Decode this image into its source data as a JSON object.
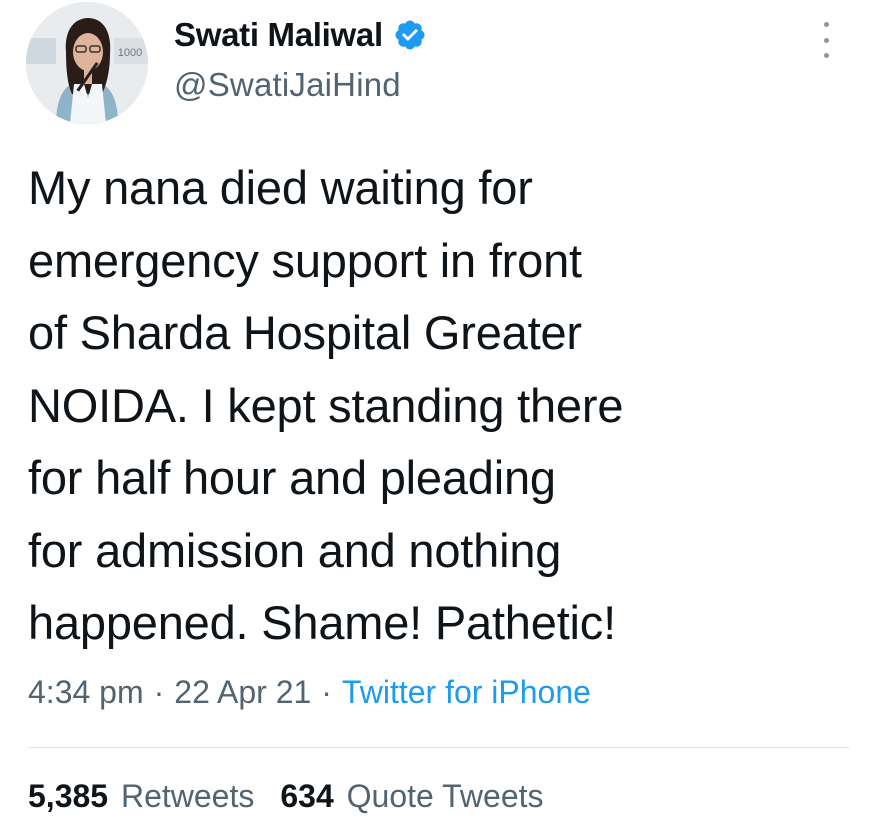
{
  "author": {
    "display_name": "Swati Maliwal",
    "handle": "@SwatiJaiHind",
    "verified": true,
    "avatar_backdrop_text": "1000"
  },
  "tweet": {
    "text": "My nana died waiting for\nemergency support in front\nof Sharda Hospital Greater\nNOIDA. I kept standing there\nfor half hour and pleading\nfor admission and nothing\nhappened. Shame! Pathetic!",
    "time": "4:34 pm",
    "date": "22 Apr 21",
    "separator": "·",
    "source": "Twitter for iPhone"
  },
  "stats": {
    "retweets_count": "5,385",
    "retweets_label": "Retweets",
    "quote_tweets_count": "634",
    "quote_tweets_label": "Quote Tweets"
  },
  "icons": {
    "verified": "verified-badge-icon",
    "more": "more-options-icon"
  },
  "colors": {
    "text": "#0f1419",
    "secondary": "#536471",
    "accent": "#1d9bf0",
    "divider": "#e1e6ea"
  }
}
